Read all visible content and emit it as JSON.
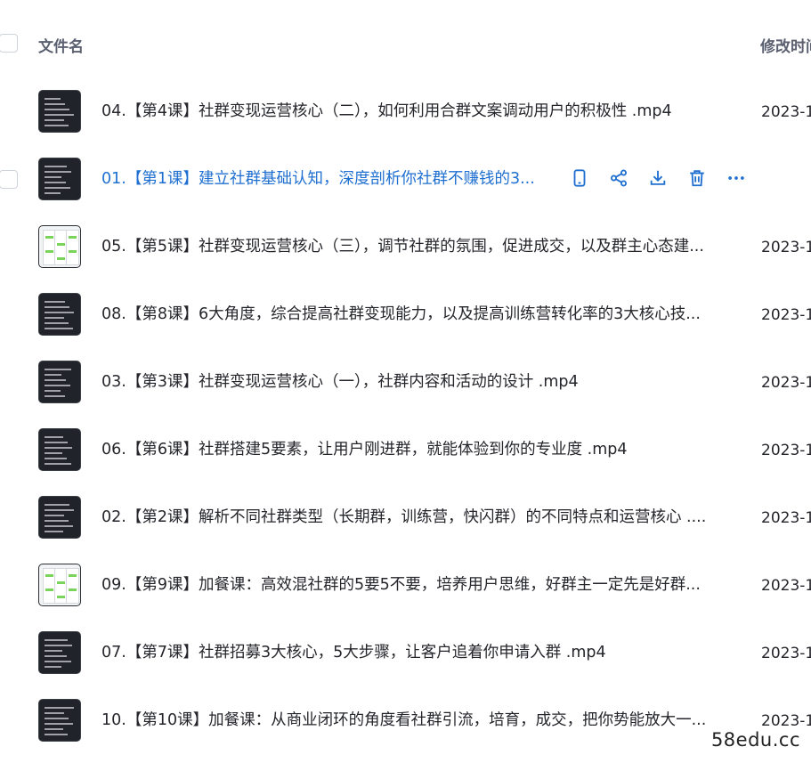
{
  "header": {
    "name_label": "文件名",
    "time_label": "修改时间"
  },
  "files": [
    {
      "name": "04.【第4课】社群变现运营核心（二），如何利用合群文案调动用户的积极性 .mp4",
      "time": "2023-1",
      "thumb": "dark"
    },
    {
      "name": "01.【第1课】建立社群基础认知，深度剖析你社群不赚钱的3...",
      "time": "",
      "thumb": "dark",
      "active": true
    },
    {
      "name": "05.【第5课】社群变现运营核心（三），调节社群的氛围，促进成交，以及群主心态建...",
      "time": "2023-1",
      "thumb": "light"
    },
    {
      "name": "08.【第8课】6大角度，综合提高社群变现能力，以及提高训练营转化率的3大核心技...",
      "time": "2023-1",
      "thumb": "dark"
    },
    {
      "name": "03.【第3课】社群变现运营核心（一），社群内容和活动的设计 .mp4",
      "time": "2023-1",
      "thumb": "dark"
    },
    {
      "name": "06.【第6课】社群搭建5要素，让用户刚进群，就能体验到你的专业度 .mp4",
      "time": "2023-1",
      "thumb": "dark"
    },
    {
      "name": "02.【第2课】解析不同社群类型（长期群，训练营，快闪群）的不同特点和运营核心 ....",
      "time": "2023-1",
      "thumb": "dark"
    },
    {
      "name": "09.【第9课】加餐课：高效混社群的5要5不要，培养用户思维，好群主一定先是好群...",
      "time": "2023-1",
      "thumb": "light"
    },
    {
      "name": "07.【第7课】社群招募3大核心，5大步骤，让客户追着你申请入群 .mp4",
      "time": "2023-1",
      "thumb": "dark"
    },
    {
      "name": "10.【第10课】加餐课：从商业闭环的角度看社群引流，培育，成交，把你势能放大一...",
      "time": "2023-1",
      "thumb": "dark"
    }
  ],
  "row_actions": [
    "phone-icon",
    "share-icon",
    "download-icon",
    "trash-icon",
    "more-icon"
  ],
  "colors": {
    "active": "#1f6fd1",
    "text": "#25262b",
    "header": "#5b6070"
  },
  "watermark": "58edu.cc"
}
